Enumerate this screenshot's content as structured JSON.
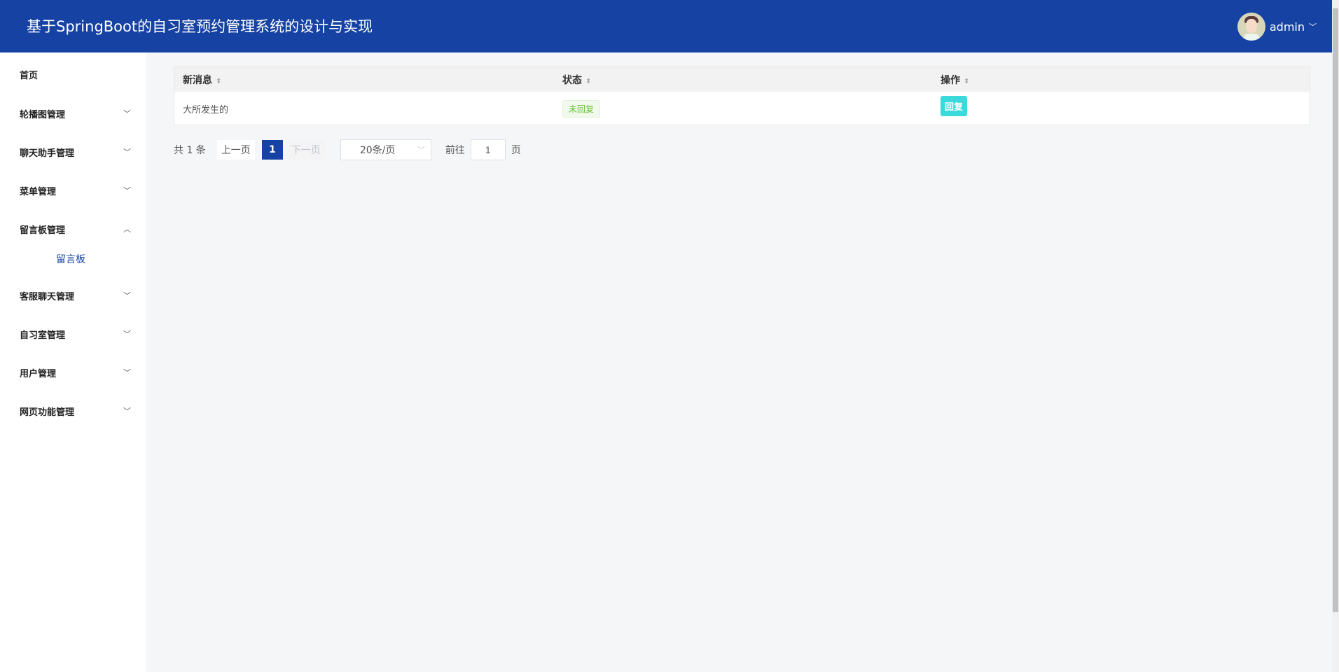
{
  "header": {
    "title": "基于SpringBoot的自习室预约管理系统的设计与实现",
    "user": "admin"
  },
  "sidebar": {
    "items": [
      {
        "label": "首页"
      },
      {
        "label": "轮播图管理"
      },
      {
        "label": "聊天助手管理"
      },
      {
        "label": "菜单管理"
      },
      {
        "label": "留言板管理",
        "expanded": true,
        "children": [
          {
            "label": "留言板",
            "active": true
          }
        ]
      },
      {
        "label": "客服聊天管理"
      },
      {
        "label": "自习室管理"
      },
      {
        "label": "用户管理"
      },
      {
        "label": "网页功能管理"
      }
    ]
  },
  "table": {
    "columns": [
      "新消息",
      "状态",
      "操作"
    ],
    "rows": [
      {
        "message": "大所发生的",
        "status": "未回复",
        "action": "回复"
      }
    ]
  },
  "pagination": {
    "total": "共 1 条",
    "prev": "上一页",
    "current": "1",
    "next": "下一页",
    "page_size": "20条/页",
    "goto": "前往",
    "goto_value": "1",
    "page_unit": "页"
  },
  "colors": {
    "header": "#1643a3",
    "reply_button": "#3ad9dc",
    "status_tag": "#67c23a"
  }
}
